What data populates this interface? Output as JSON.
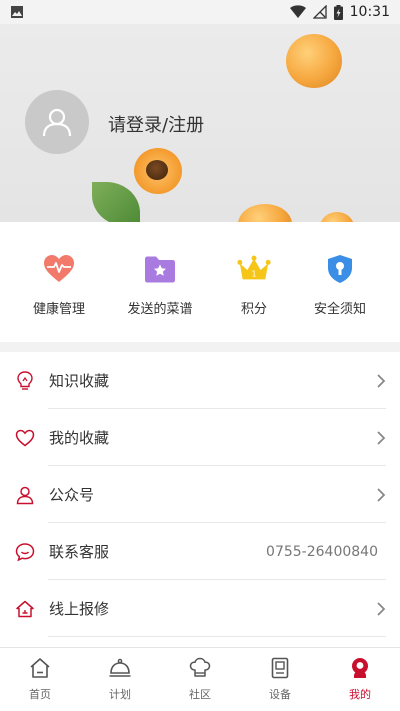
{
  "status_bar": {
    "time": "10:31"
  },
  "header": {
    "login_text": "请登录/注册"
  },
  "quick_actions": [
    {
      "label": "健康管理",
      "icon": "heart-pulse-icon"
    },
    {
      "label": "发送的菜谱",
      "icon": "star-folder-icon"
    },
    {
      "label": "积分",
      "icon": "crown-icon"
    },
    {
      "label": "安全须知",
      "icon": "shield-icon"
    }
  ],
  "menu": [
    {
      "label": "知识收藏",
      "icon": "lightbulb-icon",
      "value": ""
    },
    {
      "label": "我的收藏",
      "icon": "heart-icon",
      "value": ""
    },
    {
      "label": "公众号",
      "icon": "user-icon",
      "value": ""
    },
    {
      "label": "联系客服",
      "icon": "chat-icon",
      "value": "0755-26400840"
    },
    {
      "label": "线上报修",
      "icon": "home-repair-icon",
      "value": ""
    }
  ],
  "bottom_nav": [
    {
      "label": "首页",
      "icon": "home-icon"
    },
    {
      "label": "计划",
      "icon": "cloche-icon"
    },
    {
      "label": "社区",
      "icon": "chef-hat-icon"
    },
    {
      "label": "设备",
      "icon": "device-icon"
    },
    {
      "label": "我的",
      "icon": "profile-icon",
      "active": true
    }
  ],
  "colors": {
    "accent": "#c8102e",
    "header_bg": "#e6e6e6"
  }
}
